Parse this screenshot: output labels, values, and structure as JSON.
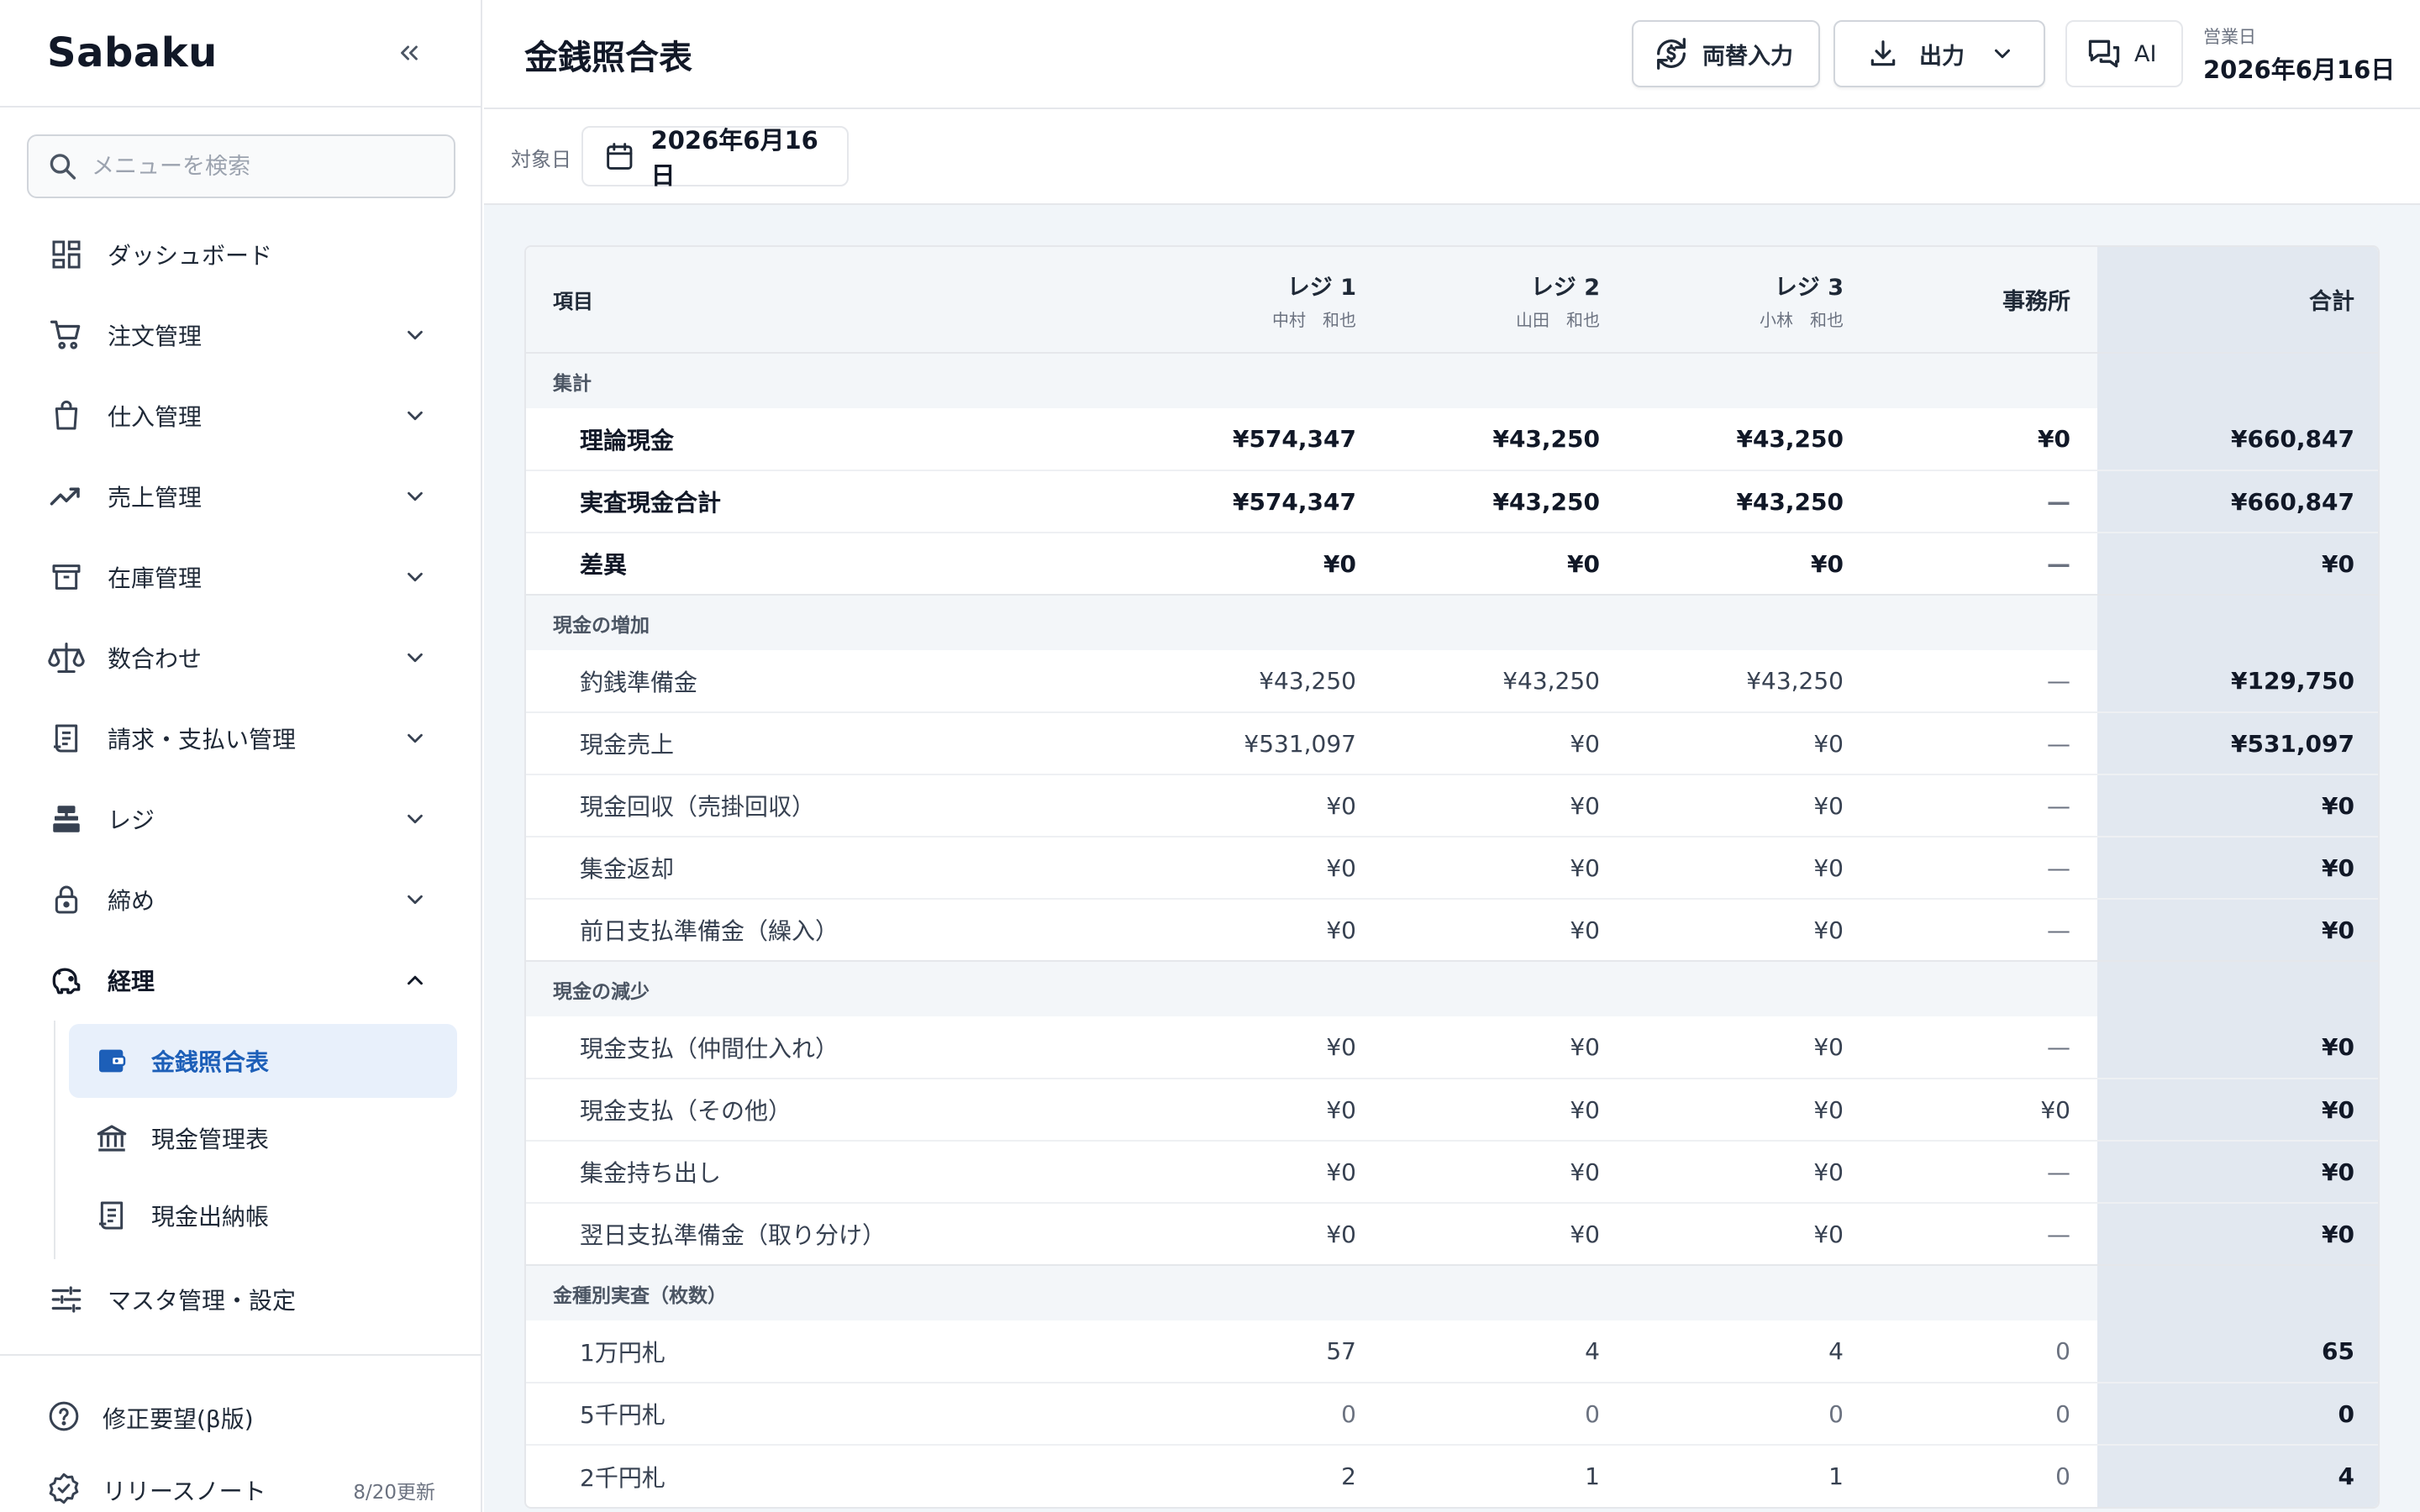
{
  "sidebar": {
    "brand": "Sabaku",
    "search_placeholder": "メニューを検索",
    "items": [
      {
        "label": "ダッシュボード",
        "icon": "dashboard-icon",
        "expandable": false
      },
      {
        "label": "注文管理",
        "icon": "cart-icon",
        "expandable": true
      },
      {
        "label": "仕入管理",
        "icon": "shopping-bag-icon",
        "expandable": true
      },
      {
        "label": "売上管理",
        "icon": "trending-up-icon",
        "expandable": true
      },
      {
        "label": "在庫管理",
        "icon": "archive-box-icon",
        "expandable": true
      },
      {
        "label": "数合わせ",
        "icon": "scale-icon",
        "expandable": true
      },
      {
        "label": "請求・支払い管理",
        "icon": "receipt-icon",
        "expandable": true
      },
      {
        "label": "レジ",
        "icon": "register-icon",
        "expandable": true
      },
      {
        "label": "締め",
        "icon": "lock-icon",
        "expandable": true
      },
      {
        "label": "経理",
        "icon": "piggy-bank-icon",
        "expandable": true,
        "open": true
      }
    ],
    "sub_items": [
      {
        "label": "金銭照合表",
        "icon": "wallet-icon",
        "active": true
      },
      {
        "label": "現金管理表",
        "icon": "bank-icon",
        "active": false
      },
      {
        "label": "現金出納帳",
        "icon": "ledger-icon",
        "active": false
      }
    ],
    "settings_label": "マスタ管理・設定",
    "footer": {
      "feedback_label": "修正要望(β版)",
      "release_label": "リリースノート",
      "release_note": "8/20更新"
    }
  },
  "header": {
    "title": "金銭照合表",
    "exchange_label": "両替入力",
    "export_label": "出力",
    "ai_label": "AI",
    "business_date_label": "営業日",
    "business_date": "2026年6月16日"
  },
  "filter": {
    "label": "対象日",
    "date": "2026年6月16日"
  },
  "colors": {
    "accent": "#1d5fb8",
    "active_bg": "#e8f0fb",
    "total_col_bg": "#e2e8f0",
    "section_bg": "#f3f6f9",
    "content_bg": "#f1f5f9"
  },
  "table": {
    "columns": [
      {
        "label": "項目",
        "sub": ""
      },
      {
        "label": "レジ 1",
        "sub": "中村　和也"
      },
      {
        "label": "レジ 2",
        "sub": "山田　和也"
      },
      {
        "label": "レジ 3",
        "sub": "小林　和也"
      },
      {
        "label": "事務所",
        "sub": ""
      },
      {
        "label": "合計",
        "sub": ""
      }
    ],
    "sections": [
      {
        "title": "集計",
        "bold": true,
        "rows": [
          {
            "label": "理論現金",
            "values": [
              "¥574,347",
              "¥43,250",
              "¥43,250",
              "¥0",
              "¥660,847"
            ]
          },
          {
            "label": "実査現金合計",
            "values": [
              "¥574,347",
              "¥43,250",
              "¥43,250",
              "—",
              "¥660,847"
            ]
          },
          {
            "label": "差異",
            "values": [
              "¥0",
              "¥0",
              "¥0",
              "—",
              "¥0"
            ]
          }
        ]
      },
      {
        "title": "現金の増加",
        "bold": false,
        "rows": [
          {
            "label": "釣銭準備金",
            "values": [
              "¥43,250",
              "¥43,250",
              "¥43,250",
              "—",
              "¥129,750"
            ]
          },
          {
            "label": "現金売上",
            "values": [
              "¥531,097",
              "¥0",
              "¥0",
              "—",
              "¥531,097"
            ]
          },
          {
            "label": "現金回収（売掛回収）",
            "values": [
              "¥0",
              "¥0",
              "¥0",
              "—",
              "¥0"
            ]
          },
          {
            "label": "集金返却",
            "values": [
              "¥0",
              "¥0",
              "¥0",
              "—",
              "¥0"
            ]
          },
          {
            "label": "前日支払準備金（繰入）",
            "values": [
              "¥0",
              "¥0",
              "¥0",
              "—",
              "¥0"
            ]
          }
        ]
      },
      {
        "title": "現金の減少",
        "bold": false,
        "rows": [
          {
            "label": "現金支払（仲間仕入れ）",
            "values": [
              "¥0",
              "¥0",
              "¥0",
              "—",
              "¥0"
            ]
          },
          {
            "label": "現金支払（その他）",
            "values": [
              "¥0",
              "¥0",
              "¥0",
              "¥0",
              "¥0"
            ]
          },
          {
            "label": "集金持ち出し",
            "values": [
              "¥0",
              "¥0",
              "¥0",
              "—",
              "¥0"
            ]
          },
          {
            "label": "翌日支払準備金（取り分け）",
            "values": [
              "¥0",
              "¥0",
              "¥0",
              "—",
              "¥0"
            ]
          }
        ]
      },
      {
        "title": "金種別実査（枚数）",
        "bold": false,
        "rows": [
          {
            "label": "1万円札",
            "values": [
              "57",
              "4",
              "4",
              "0",
              "65"
            ]
          },
          {
            "label": "5千円札",
            "values": [
              "0",
              "0",
              "0",
              "0",
              "0"
            ]
          },
          {
            "label": "2千円札",
            "values": [
              "2",
              "1",
              "1",
              "0",
              "4"
            ]
          }
        ]
      }
    ]
  }
}
